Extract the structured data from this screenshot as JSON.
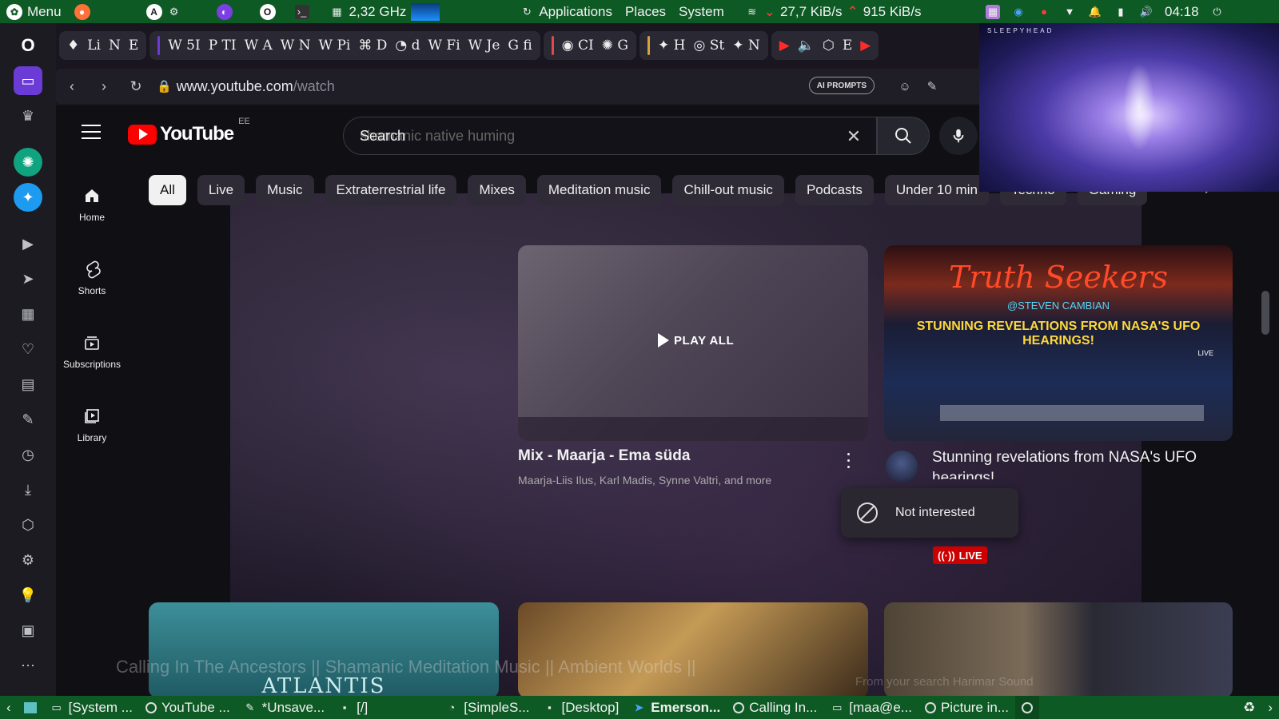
{
  "system_top": {
    "menu_label": "Menu",
    "cpu_freq": "2,32 GHz",
    "menus": [
      "Applications",
      "Places",
      "System"
    ],
    "net_down": "27,7 KiB/s",
    "net_up": "915 KiB/s",
    "clock": "04:18"
  },
  "tabs": {
    "group1": [
      "Li",
      "N",
      "E"
    ],
    "group2": [
      "5I",
      "TI",
      "A",
      "N",
      "Pi",
      "D",
      "d",
      "Fi",
      "Je",
      "fi"
    ],
    "group3": [
      "CI",
      "G"
    ],
    "group4": [
      "H",
      "St",
      "N"
    ],
    "group5": [
      "E"
    ]
  },
  "address_bar": {
    "domain": "www.youtube.com",
    "path": "/watch",
    "ai_button": "AI PROMPTS"
  },
  "youtube": {
    "logo_text": "YouTube",
    "country": "EE",
    "search": {
      "overlay": "Search",
      "value": "shamanic native huming"
    },
    "nav": [
      {
        "label": "Home",
        "icon": "home-icon"
      },
      {
        "label": "Shorts",
        "icon": "shorts-icon"
      },
      {
        "label": "Subscriptions",
        "icon": "subscriptions-icon"
      },
      {
        "label": "Library",
        "icon": "library-icon"
      }
    ],
    "chips": [
      "All",
      "Live",
      "Music",
      "Extraterrestrial life",
      "Mixes",
      "Meditation music",
      "Chill-out music",
      "Podcasts",
      "Under 10 min",
      "Techno",
      "Gaming"
    ],
    "mix_card": {
      "play_all": "PLAY ALL",
      "title": "Mix - Maarja - Ema süda",
      "artists": "Maarja-Liis Ilus, Karl Madis, Synne Valtri, and more"
    },
    "ufo_card": {
      "thumb_title": "Truth Seekers",
      "thumb_handle": "@STEVEN CAMBIAN",
      "thumb_headline": "STUNNING REVELATIONS FROM NASA'S UFO HEARINGS!",
      "thumb_live": "LIVE",
      "title": "Stunning revelations from NASA's UFO hearings!",
      "live_badge": "LIVE"
    },
    "context_menu": {
      "item": "Not interested"
    },
    "row2": {
      "atlantis_word": "ATLANTIS",
      "overlay_title": "Calling In The Ancestors || Shamanic Meditation Music || Ambient Worlds ||",
      "overlay_sub": "From your search     Harimar Sound"
    }
  },
  "pip": {
    "label": "SLEEPYHEAD"
  },
  "taskbar": {
    "items": [
      "[System ...",
      "YouTube ...",
      "*Unsave...",
      "[/]",
      "[SimpleS...",
      "[Desktop]",
      "Emerson...",
      "Calling In...",
      "[maa@e...",
      "Picture in..."
    ]
  },
  "colors": {
    "panel_green": "#0e5a25",
    "yt_red": "#ff0000",
    "opera_purple": "#6b3bd6",
    "live_red": "#cc0000"
  }
}
